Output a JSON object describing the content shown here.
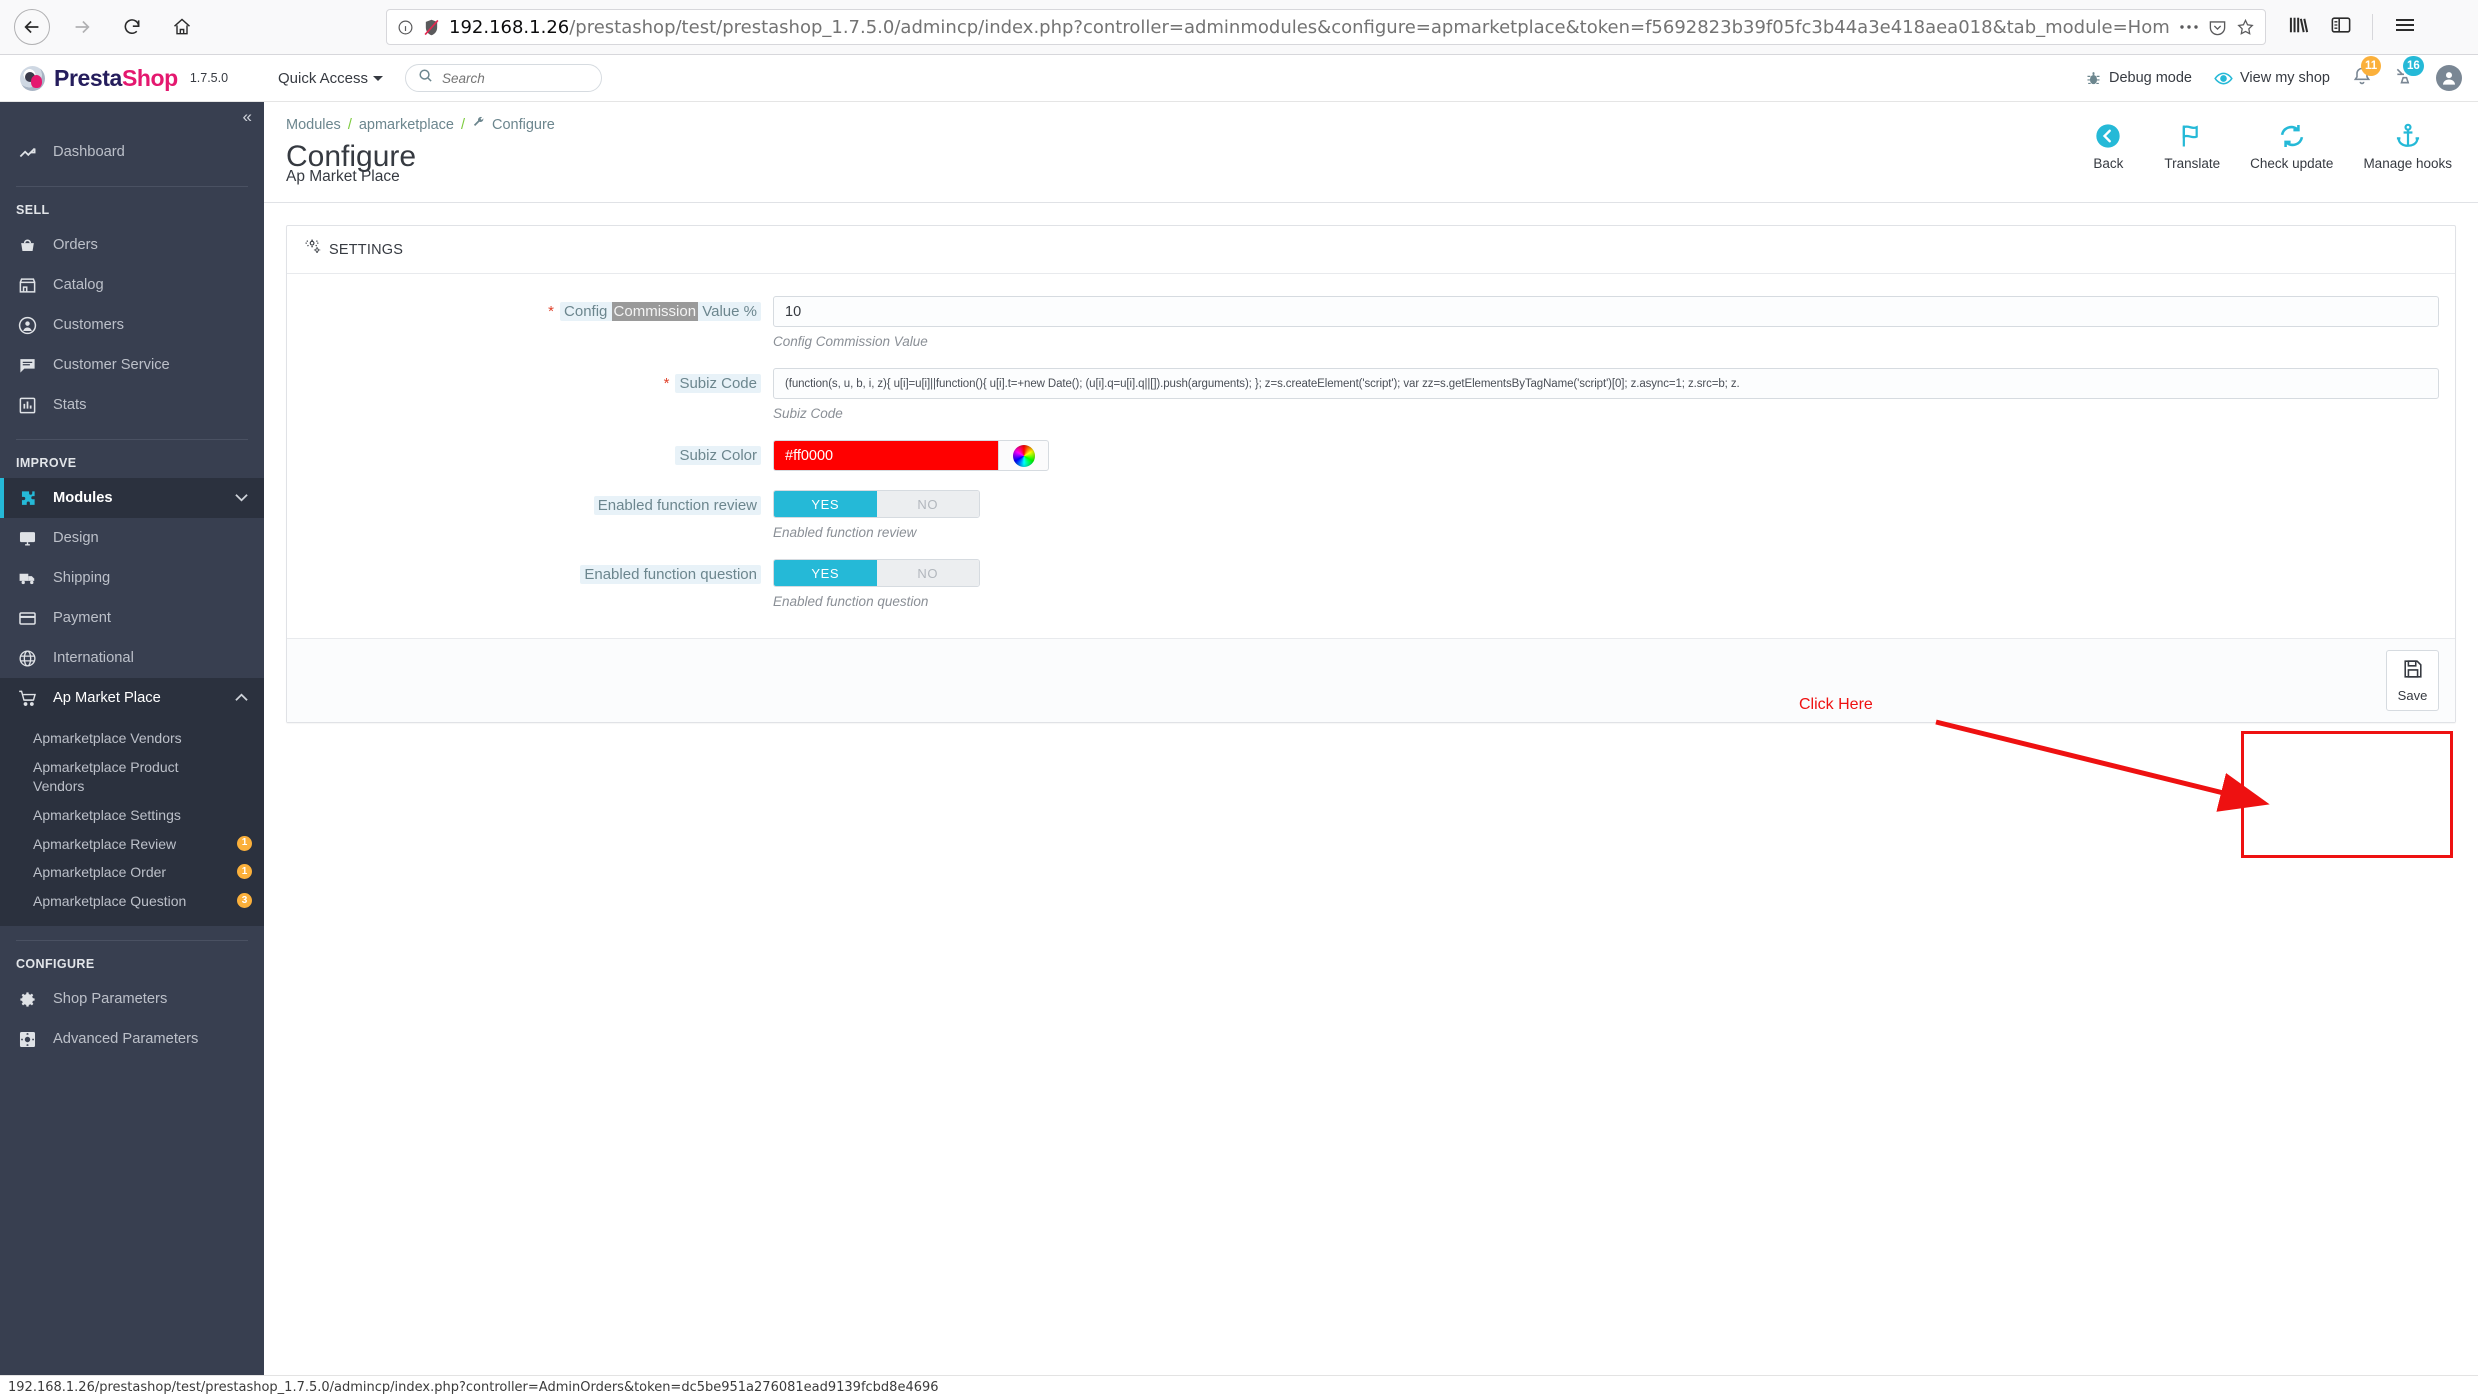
{
  "browser": {
    "back_icon": "back-arrow-icon",
    "forward_icon": "forward-arrow-icon",
    "reload_icon": "reload-icon",
    "home_icon": "home-icon",
    "url_host": "192.168.1.26",
    "url_path": "/prestashop/test/prestashop_1.7.5.0/admincp/index.php?controller=adminmodules&configure=apmarketplace&token=f5692823b39f05fc3b44a3e418aea018&tab_module=Home&module_name=apmarketp",
    "info_icon": "page-info-icon",
    "tracking_icon": "tracking-protection-icon",
    "more_icon": "page-actions-icon",
    "pocket_icon": "pocket-icon",
    "star_icon": "bookmark-star-icon",
    "library_icon": "library-icon",
    "sidebar_icon": "sidebar-toggle-icon",
    "menu_icon": "hamburger-menu-icon"
  },
  "header": {
    "brand_presta": "Presta",
    "brand_shop": "Shop",
    "version": "1.7.5.0",
    "quick_access": "Quick Access",
    "search_placeholder": "Search",
    "search_value": "",
    "debug_mode": "Debug mode",
    "view_my_shop": "View my shop",
    "notifications_badge": "11",
    "orders_badge": "16",
    "accent_blue": "#25b9d7",
    "badge_orange": "#fbb03b"
  },
  "sidebar": {
    "collapse_label": "«",
    "dashboard": "Dashboard",
    "section_sell": "SELL",
    "sell_items": [
      {
        "label": "Orders",
        "icon": "basket-icon"
      },
      {
        "label": "Catalog",
        "icon": "store-icon"
      },
      {
        "label": "Customers",
        "icon": "person-icon"
      },
      {
        "label": "Customer Service",
        "icon": "chat-icon"
      },
      {
        "label": "Stats",
        "icon": "bar-chart-icon"
      }
    ],
    "section_improve": "IMPROVE",
    "improve_items": [
      {
        "label": "Modules",
        "icon": "puzzle-icon",
        "active": true,
        "chevron": "down"
      },
      {
        "label": "Design",
        "icon": "monitor-icon"
      },
      {
        "label": "Shipping",
        "icon": "truck-icon"
      },
      {
        "label": "Payment",
        "icon": "card-icon"
      },
      {
        "label": "International",
        "icon": "globe-icon"
      }
    ],
    "marketplace": {
      "label": "Ap Market Place",
      "icon": "cart-icon",
      "chevron": "up"
    },
    "marketplace_sub": [
      {
        "label": "Apmarketplace Vendors",
        "badge": ""
      },
      {
        "label": "Apmarketplace Product Vendors",
        "badge": ""
      },
      {
        "label": "Apmarketplace Settings",
        "badge": ""
      },
      {
        "label": "Apmarketplace Review",
        "badge": "1"
      },
      {
        "label": "Apmarketplace Order",
        "badge": "1"
      },
      {
        "label": "Apmarketplace Question",
        "badge": "3"
      }
    ],
    "section_configure": "CONFIGURE",
    "configure_items": [
      {
        "label": "Shop Parameters",
        "icon": "gear-icon"
      },
      {
        "label": "Advanced Parameters",
        "icon": "gear-square-icon"
      }
    ]
  },
  "page": {
    "breadcrumb": [
      "Modules",
      "apmarketplace",
      "Configure"
    ],
    "title": "Configure",
    "subtitle": "Ap Market Place",
    "actions": [
      {
        "label": "Back",
        "icon": "back-circle-icon"
      },
      {
        "label": "Translate",
        "icon": "flag-icon"
      },
      {
        "label": "Check update",
        "icon": "refresh-icon"
      },
      {
        "label": "Manage hooks",
        "icon": "anchor-icon"
      }
    ]
  },
  "settings": {
    "panel_title": "SETTINGS",
    "panel_icon": "gears-icon",
    "fields": [
      {
        "label_prefix": "Config ",
        "label_selected": "Commission",
        "label_suffix": " Value %",
        "required": true,
        "value": "10",
        "help": "Config Commission Value"
      },
      {
        "label": "Subiz Code",
        "required": true,
        "value": "(function(s, u, b, i, z){ u[i]=u[i]||function(){ u[i].t=+new Date();          (u[i].q=u[i].q||[]).push(arguments); };          z=s.createElement('script'); var zz=s.getElementsByTagName('script')[0]; z.async=1;          z.src=b; z.",
        "help": "Subiz Code"
      },
      {
        "label": "Subiz Color",
        "required": false,
        "value": "#ff0000",
        "color": "#ff0000",
        "swatch_icon": "color-wheel-icon"
      },
      {
        "label": "Enabled function review",
        "required": false,
        "yes": "YES",
        "no": "NO",
        "state": "yes",
        "help": "Enabled function review"
      },
      {
        "label": "Enabled function question",
        "required": false,
        "yes": "YES",
        "no": "NO",
        "state": "yes",
        "help": "Enabled function question"
      }
    ],
    "save_label": "Save",
    "save_icon": "floppy-disk-icon"
  },
  "annotation": {
    "click_here": "Click Here",
    "color": "#ee1111"
  },
  "statusbar": {
    "text": "192.168.1.26/prestashop/test/prestashop_1.7.5.0/admincp/index.php?controller=AdminOrders&token=dc5be951a276081ead9139fcbd8e4696"
  }
}
